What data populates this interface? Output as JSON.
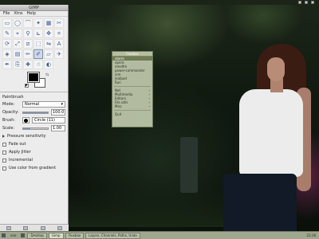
{
  "desktop": {
    "taskbar": {
      "workspace": "one",
      "tasks": [
        {
          "label": "Desktop"
        },
        {
          "label": "Gimp"
        },
        {
          "label": "Fluxbox"
        },
        {
          "label": "Layers, Channels, Paths, Undo"
        }
      ],
      "clock": "21:16"
    }
  },
  "toolbox": {
    "title": "GIMP",
    "menu": [
      "File",
      "Xtns",
      "Help"
    ],
    "tools": [
      {
        "icon": "rect-select-icon",
        "glyph": "▭"
      },
      {
        "icon": "ellipse-select-icon",
        "glyph": "◯"
      },
      {
        "icon": "free-select-icon",
        "glyph": "⌒"
      },
      {
        "icon": "fuzzy-select-icon",
        "glyph": "✦"
      },
      {
        "icon": "color-select-icon",
        "glyph": "▦"
      },
      {
        "icon": "scissors-icon",
        "glyph": "✂"
      },
      {
        "icon": "paths-icon",
        "glyph": "✎"
      },
      {
        "icon": "color-picker-icon",
        "glyph": "⌖"
      },
      {
        "icon": "zoom-icon",
        "glyph": "⚲"
      },
      {
        "icon": "measure-icon",
        "glyph": "⊾"
      },
      {
        "icon": "move-icon",
        "glyph": "✥"
      },
      {
        "icon": "crop-icon",
        "glyph": "⌗"
      },
      {
        "icon": "rotate-icon",
        "glyph": "⟳"
      },
      {
        "icon": "scale-icon",
        "glyph": "⤢"
      },
      {
        "icon": "shear-icon",
        "glyph": "⧄"
      },
      {
        "icon": "perspective-icon",
        "glyph": "⬚"
      },
      {
        "icon": "flip-icon",
        "glyph": "⇋"
      },
      {
        "icon": "text-icon",
        "glyph": "A"
      },
      {
        "icon": "bucket-fill-icon",
        "glyph": "◈"
      },
      {
        "icon": "blend-icon",
        "glyph": "▤"
      },
      {
        "icon": "pencil-icon",
        "glyph": "✏"
      },
      {
        "icon": "paintbrush-icon",
        "glyph": "✐"
      },
      {
        "icon": "eraser-icon",
        "glyph": "▱"
      },
      {
        "icon": "airbrush-icon",
        "glyph": "✈"
      },
      {
        "icon": "ink-icon",
        "glyph": "✒"
      },
      {
        "icon": "clone-icon",
        "glyph": "⎘"
      },
      {
        "icon": "heal-icon",
        "glyph": "✚"
      },
      {
        "icon": "smudge-icon",
        "glyph": "☝"
      },
      {
        "icon": "dodge-burn-icon",
        "glyph": "◐"
      }
    ],
    "active_tool_index": 21,
    "colors": {
      "foreground": "#000000",
      "background": "#ffffff"
    },
    "options": {
      "title": "Paintbrush",
      "mode_label": "Mode:",
      "mode_value": "Normal",
      "opacity_label": "Opacity:",
      "opacity_value": "100.0",
      "opacity_fraction": 1.0,
      "brush_label": "Brush:",
      "brush_value": "Circle (11)",
      "scale_label": "Scale:",
      "scale_value": "1.00",
      "scale_fraction": 0.3,
      "pressure": "Pressure sensitivity",
      "checks": [
        {
          "label": "Fade out"
        },
        {
          "label": "Apply Jitter"
        },
        {
          "label": "Incremental"
        },
        {
          "label": "Use color from gradient"
        }
      ]
    }
  },
  "menu": {
    "title": "Fluxbox",
    "items": [
      {
        "label": "xterm",
        "submenu": false
      },
      {
        "label": "opera",
        "submenu": false
      },
      {
        "label": "emelfm",
        "submenu": false
      },
      {
        "label": "power-commander",
        "submenu": false
      },
      {
        "label": "vim",
        "submenu": false
      },
      {
        "label": "leafpad",
        "submenu": false
      },
      {
        "label": "Run",
        "submenu": false
      }
    ],
    "items2": [
      {
        "label": "Net",
        "submenu": true
      },
      {
        "label": "Multimedia",
        "submenu": true
      },
      {
        "label": "Editors",
        "submenu": true
      },
      {
        "label": "File utils",
        "submenu": true
      },
      {
        "label": "Misc",
        "submenu": true
      }
    ],
    "items3": [
      {
        "label": "Quit",
        "submenu": false
      }
    ],
    "highlighted_index": 0
  }
}
